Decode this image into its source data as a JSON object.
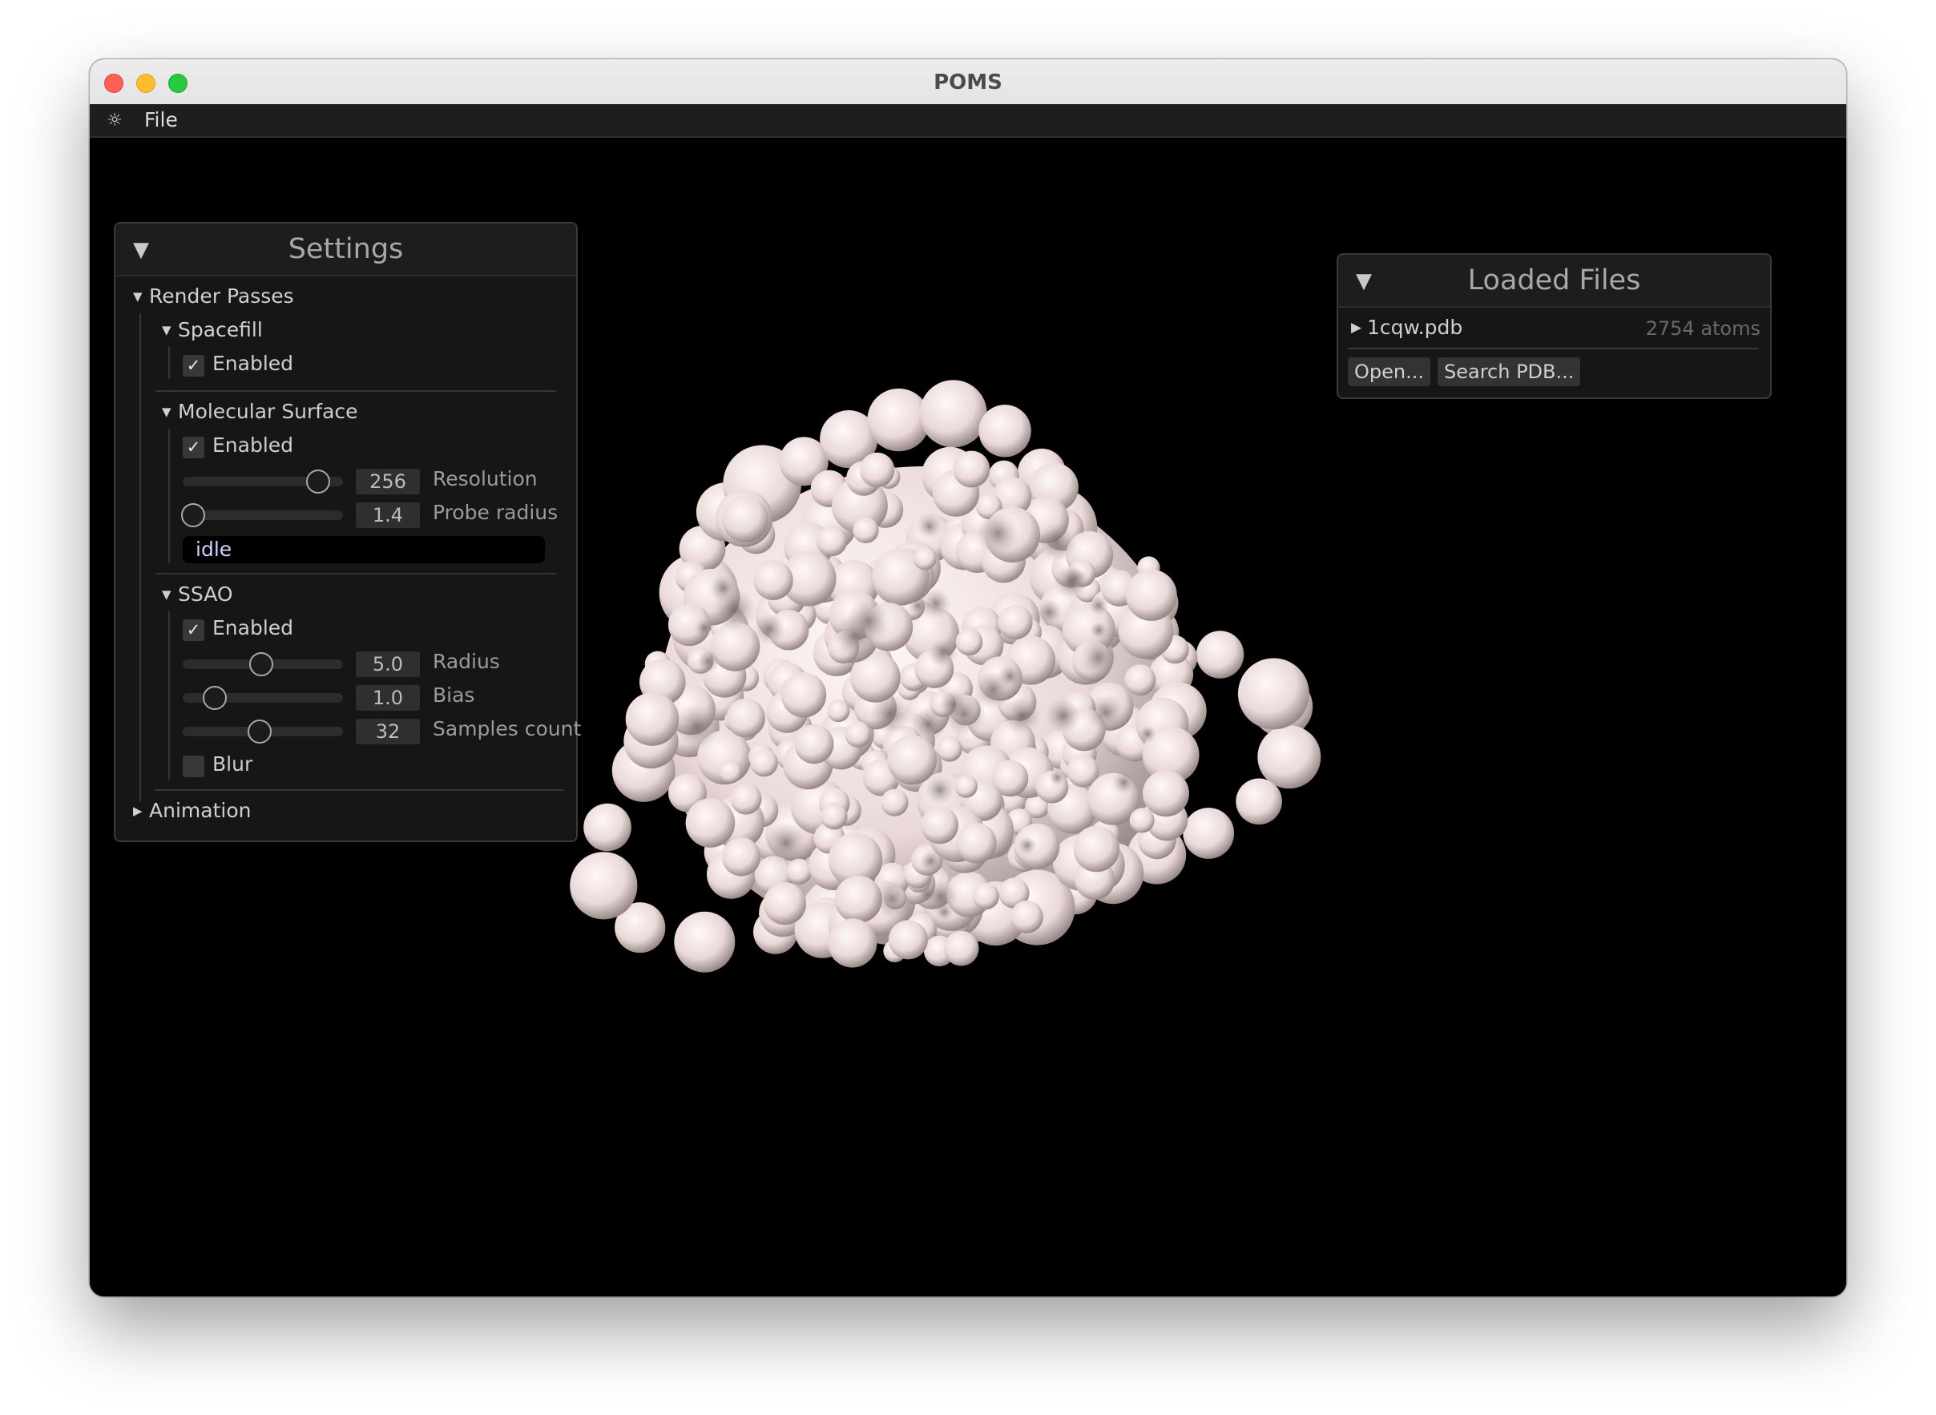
{
  "window": {
    "title": "POMS"
  },
  "menubar": {
    "icon": "gear-icon",
    "file_label": "File"
  },
  "settings": {
    "title": "Settings",
    "render_passes_label": "Render Passes",
    "spacefill": {
      "label": "Spacefill",
      "enabled_label": "Enabled",
      "enabled": true
    },
    "molecular_surface": {
      "label": "Molecular Surface",
      "enabled_label": "Enabled",
      "enabled": true,
      "resolution": {
        "label": "Resolution",
        "value": "256",
        "fraction": 0.92
      },
      "probe_radius": {
        "label": "Probe radius",
        "value": "1.4",
        "fraction": 0.0
      },
      "status": "idle"
    },
    "ssao": {
      "label": "SSAO",
      "enabled_label": "Enabled",
      "enabled": true,
      "radius": {
        "label": "Radius",
        "value": "5.0",
        "fraction": 0.5
      },
      "bias": {
        "label": "Bias",
        "value": "1.0",
        "fraction": 0.16
      },
      "samples": {
        "label": "Samples count",
        "value": "32",
        "fraction": 0.49
      },
      "blur_label": "Blur",
      "blur": false
    },
    "animation_label": "Animation"
  },
  "loaded_files": {
    "title": "Loaded Files",
    "files": [
      {
        "name": "1cqw.pdb",
        "atoms": "2754 atoms"
      }
    ],
    "open_label": "Open...",
    "search_label": "Search PDB..."
  },
  "colors": {
    "surface": "#f2e4e4",
    "background": "#000000"
  }
}
